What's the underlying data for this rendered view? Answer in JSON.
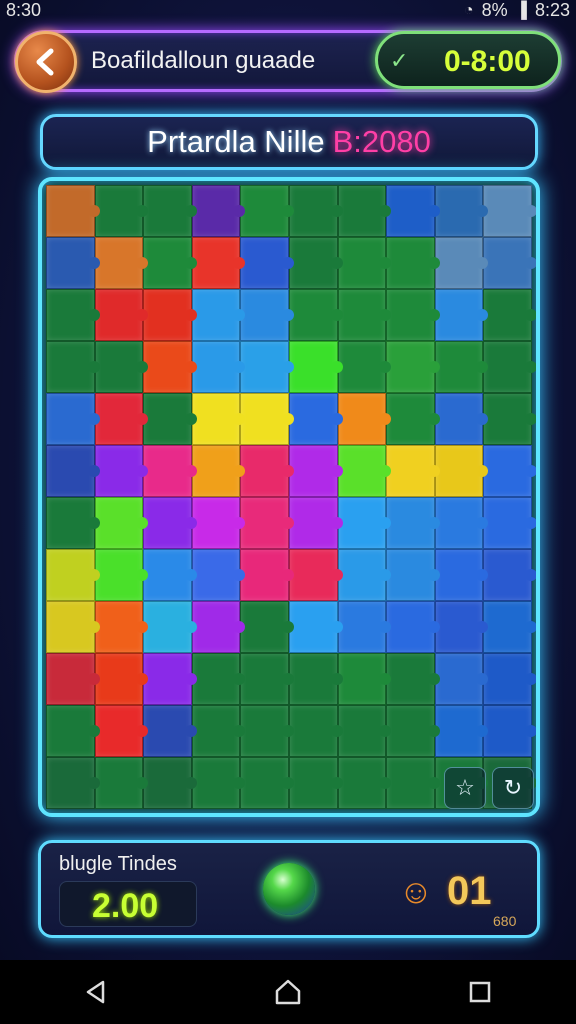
{
  "status": {
    "time": "8:30",
    "battery": "8%",
    "clock_right": "8:23"
  },
  "header": {
    "title": "Boafildalloun guaade",
    "score": "0-8:00"
  },
  "puzzle": {
    "name": "Prtardla Nille",
    "code": "B:2080"
  },
  "bottom": {
    "label": "blugle Tindes",
    "time_value": "2.00",
    "count": "01",
    "count_sub": "680"
  },
  "icons": {
    "back": "chevron-left-icon",
    "score": "check-icon",
    "tool_a": "shapes-icon",
    "tool_b": "rotate-icon",
    "orb": "gem-orb-icon",
    "mascot": "mascot-icon"
  },
  "colors": {
    "accent_purple": "#b66bff",
    "accent_cyan": "#5fe5ff",
    "score_green": "#d7ff3a",
    "title_pink": "#ff3fa6"
  },
  "pieces": [
    "#c26a2a",
    "#1a7a3a",
    "#1a7a3a",
    "#5a2aa8",
    "#1e8a3a",
    "#1a7a3a",
    "#1a7a3a",
    "#1e5ec8",
    "#2a6ab0",
    "#5a8ab8",
    "#2a5ab0",
    "#d8762a",
    "#1e8a3a",
    "#e8342a",
    "#2a5ad0",
    "#1a7a3a",
    "#1e8a3a",
    "#1e8a3a",
    "#5a8ab8",
    "#3a74b8",
    "#1a7a3a",
    "#e02a2a",
    "#e23020",
    "#2a9ae8",
    "#2a8ae0",
    "#1e8a3a",
    "#1e8a3a",
    "#1e8a3a",
    "#2a8ae0",
    "#1a7a3a",
    "#1a7a3a",
    "#1a7a3a",
    "#ea4a1a",
    "#2a9ae8",
    "#2aa0e8",
    "#3ae02a",
    "#1e8a3a",
    "#2aa03a",
    "#1e8a3a",
    "#1a7a3a",
    "#2a6ad0",
    "#e2283a",
    "#1a7a3a",
    "#f0e020",
    "#f0e020",
    "#2a6ae0",
    "#f08a1a",
    "#1e8a3a",
    "#2a6ad0",
    "#1a7a3a",
    "#2a4ab0",
    "#8a2ae8",
    "#e82a8a",
    "#f0a01a",
    "#e82a6a",
    "#b02ae8",
    "#5ae02a",
    "#f0d020",
    "#e8c81a",
    "#2a6ae0",
    "#1a7a3a",
    "#5ae02a",
    "#8a2ae8",
    "#c82ae8",
    "#e82a7a",
    "#b02ae8",
    "#2aa0f0",
    "#2a8ae0",
    "#2a7ae0",
    "#2a6ae0",
    "#c0d020",
    "#4ae02a",
    "#2a8ae8",
    "#3a6ae8",
    "#e8287a",
    "#e82a5a",
    "#2a9ae8",
    "#2a8ae0",
    "#2a6ae0",
    "#2a5ad0",
    "#d8c820",
    "#f0601a",
    "#2ab0e0",
    "#a02ae8",
    "#1a7a3a",
    "#2aa0f0",
    "#2a7ae0",
    "#2a6ae0",
    "#2a5ad0",
    "#1e6ad0",
    "#c82a3a",
    "#e83a1a",
    "#8a2ae8",
    "#1a7a3a",
    "#1a7a3a",
    "#1a7a3a",
    "#1e8a3a",
    "#1a7a3a",
    "#2a6ad0",
    "#1e5ac8",
    "#1a7a3a",
    "#e82a2a",
    "#2a4ab0",
    "#1a7a3a",
    "#1a7a3a",
    "#1a7a3a",
    "#1a7a3a",
    "#1a7a3a",
    "#1e6ad0",
    "#1e5ac8",
    "#1a6a3a",
    "#1a7a3a",
    "#1a6a3a",
    "#1a7a3a",
    "#1a7a3a",
    "#1a7a3a",
    "#1a7a3a",
    "#1a7a3a",
    "#1a7a3a",
    "#1a6a3a"
  ]
}
